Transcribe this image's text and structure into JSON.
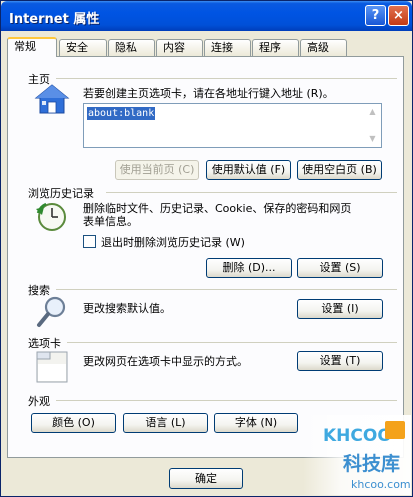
{
  "window": {
    "title": "Internet 属性",
    "help_label": "?",
    "close_label": "×"
  },
  "tabs": [
    {
      "label": "常规",
      "active": true
    },
    {
      "label": "安全"
    },
    {
      "label": "隐私"
    },
    {
      "label": "内容"
    },
    {
      "label": "连接"
    },
    {
      "label": "程序"
    },
    {
      "label": "高级"
    }
  ],
  "home": {
    "section_label": "主页",
    "description": "若要创建主页选项卡，请在各地址行键入地址 (R)。",
    "url_value": "about:blank",
    "btn_use_current": "使用当前页 (C)",
    "btn_use_default": "使用默认值 (F)",
    "btn_use_blank": "使用空白页 (B)"
  },
  "history": {
    "section_label": "浏览历史记录",
    "description_line1": "删除临时文件、历史记录、Cookie、保存的密码和网页",
    "description_line2": "表单信息。",
    "checkbox_label": "退出时删除浏览历史记录 (W)",
    "btn_delete": "删除 (D)...",
    "btn_settings": "设置 (S)"
  },
  "search": {
    "section_label": "搜索",
    "description": "更改搜索默认值。",
    "btn_settings": "设置 (I)"
  },
  "tabbed": {
    "section_label": "选项卡",
    "description": "更改网页在选项卡中显示的方式。",
    "btn_settings": "设置 (T)"
  },
  "appearance": {
    "section_label": "外观",
    "btn_colors": "颜色 (O)",
    "btn_languages": "语言 (L)",
    "btn_fonts": "字体 (N)"
  },
  "footer": {
    "btn_ok": "确定"
  },
  "watermark": {
    "brand": "KHCOO",
    "cn": "科技库",
    "domain": "khcoo.com"
  }
}
